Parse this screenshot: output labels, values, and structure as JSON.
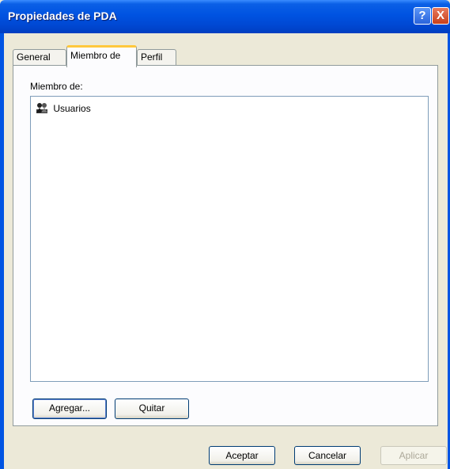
{
  "window": {
    "title": "Propiedades de PDA",
    "help_glyph": "?",
    "close_glyph": "X"
  },
  "tabs": [
    {
      "label": "General",
      "active": false
    },
    {
      "label": "Miembro de",
      "active": true
    },
    {
      "label": "Perfil",
      "active": false
    }
  ],
  "panel": {
    "label": "Miembro de:",
    "items": [
      {
        "label": "Usuarios",
        "icon": "group-icon"
      }
    ]
  },
  "buttons": {
    "add": "Agregar...",
    "remove": "Quitar",
    "ok": "Aceptar",
    "cancel": "Cancelar",
    "apply": "Aplicar"
  },
  "colors": {
    "titlebar": "#0054e3",
    "active_tab_accent": "#ffc83c",
    "dialog_bg": "#ece9d8"
  }
}
